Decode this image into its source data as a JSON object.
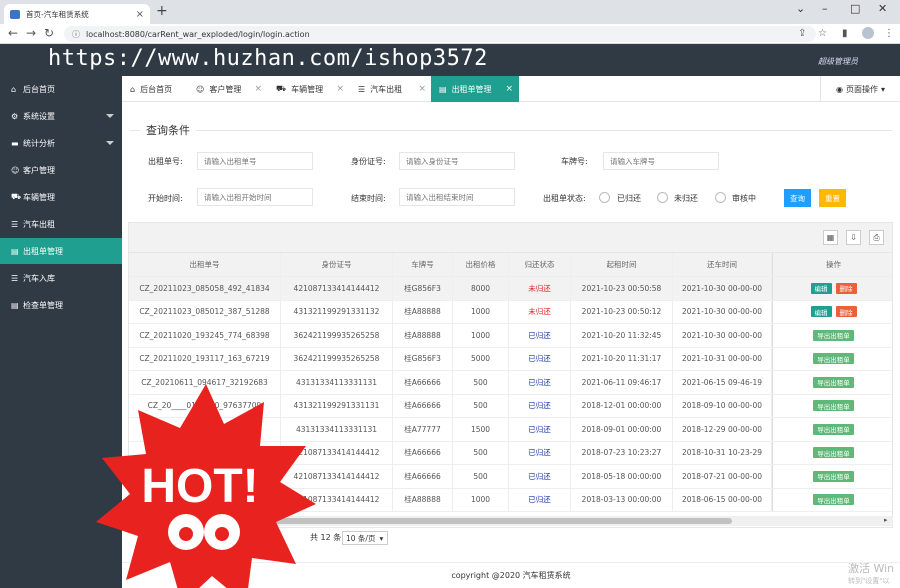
{
  "browser": {
    "tab_title": "首页-汽车租赁系统",
    "new_tab": "+",
    "url": "localhost:8080/carRent_war_exploded/login/login.action"
  },
  "header": {
    "watermark": "https://www.huzhan.com/ishop3572",
    "admin": "超级管理员"
  },
  "sidebar": {
    "items": [
      {
        "label": "后台首页",
        "icon": "home-icon"
      },
      {
        "label": "系统设置",
        "icon": "gear-icon"
      },
      {
        "label": "统计分析",
        "icon": "chart-icon"
      },
      {
        "label": "客户管理",
        "icon": "user-icon"
      },
      {
        "label": "车辆管理",
        "icon": "car-icon"
      },
      {
        "label": "汽车出租",
        "icon": "list-icon"
      },
      {
        "label": "出租单管理",
        "icon": "doc-icon"
      },
      {
        "label": "汽车入库",
        "icon": "list-icon"
      },
      {
        "label": "检查单管理",
        "icon": "doc-icon"
      }
    ]
  },
  "tabs": {
    "items": [
      {
        "label": "后台首页"
      },
      {
        "label": "客户管理"
      },
      {
        "label": "车辆管理"
      },
      {
        "label": "汽车出租"
      },
      {
        "label": "出租单管理"
      }
    ],
    "page_ops": "页面操作"
  },
  "query": {
    "title": "查询条件",
    "rent_no_label": "出租单号:",
    "rent_no_ph": "请输入出租单号",
    "idcard_label": "身份证号:",
    "idcard_ph": "请输入身份证号",
    "plate_label": "车牌号:",
    "plate_ph": "请输入车牌号",
    "start_label": "开始时间:",
    "start_ph": "请输入出租开始时间",
    "end_label": "结束时间:",
    "end_ph": "请输入出租结束时间",
    "status_label": "出租单状态:",
    "status_options": [
      "已归还",
      "未归还",
      "审核中"
    ],
    "search_btn": "查询",
    "reset_btn": "重置"
  },
  "table": {
    "columns": [
      "出租单号",
      "身份证号",
      "车牌号",
      "出租价格",
      "归还状态",
      "起租时间",
      "还车时间",
      "操作"
    ],
    "rows": [
      {
        "no": "CZ_20211023_085058_492_41834",
        "id": "421087133414144412",
        "plate": "桂G856F3",
        "price": "8000",
        "status": "未归还",
        "start": "2021-10-23 00:50:58",
        "end": "2021-10-30 00-00-00",
        "ops": [
          "编辑",
          "删除"
        ]
      },
      {
        "no": "CZ_20211023_085012_387_51288",
        "id": "431321199291331132",
        "plate": "桂A88888",
        "price": "1000",
        "status": "未归还",
        "start": "2021-10-23 00:50:12",
        "end": "2021-10-30 00-00-00",
        "ops": [
          "编辑",
          "删除"
        ]
      },
      {
        "no": "CZ_20211020_193245_774_68398",
        "id": "362421199935265258",
        "plate": "桂A88888",
        "price": "1000",
        "status": "已归还",
        "start": "2021-10-20 11:32:45",
        "end": "2021-10-30 00-00-00",
        "ops": [
          "导出出租单"
        ]
      },
      {
        "no": "CZ_20211020_193117_163_67219",
        "id": "362421199935265258",
        "plate": "桂G856F3",
        "price": "5000",
        "status": "已归还",
        "start": "2021-10-20 11:31:17",
        "end": "2021-10-31 00-00-00",
        "ops": [
          "导出出租单"
        ]
      },
      {
        "no": "CZ_20210611_094617_32192683",
        "id": "43131334113331131",
        "plate": "桂A66666",
        "price": "500",
        "status": "已归还",
        "start": "2021-06-11 09:46:17",
        "end": "2021-06-15 09-46-19",
        "ops": [
          "导出出租单"
        ]
      },
      {
        "no": "CZ_20____01_____0_97637709",
        "id": "431321199291331131",
        "plate": "桂A66666",
        "price": "500",
        "status": "已归还",
        "start": "2018-12-01 00:00:00",
        "end": "2018-09-10 00-00-00",
        "ops": [
          "导出出租单"
        ]
      },
      {
        "no": "_5",
        "id": "43131334113331131",
        "plate": "桂A77777",
        "price": "1500",
        "status": "已归还",
        "start": "2018-09-01 00:00:00",
        "end": "2018-12-29 00-00-00",
        "ops": [
          "导出出租单"
        ]
      },
      {
        "no": "",
        "id": "421087133414144412",
        "plate": "桂A66666",
        "price": "500",
        "status": "已归还",
        "start": "2018-07-23 10:23:27",
        "end": "2018-10-31 10-23-29",
        "ops": [
          "导出出租单"
        ]
      },
      {
        "no": "",
        "id": "421087133414144412",
        "plate": "桂A66666",
        "price": "500",
        "status": "已归还",
        "start": "2018-05-18 00:00:00",
        "end": "2018-07-21 00-00-00",
        "ops": [
          "导出出租单"
        ]
      },
      {
        "no": "",
        "id": "421087133414144412",
        "plate": "桂A88888",
        "price": "1000",
        "status": "已归还",
        "start": "2018-03-13 00:00:00",
        "end": "2018-06-15 00-00-00",
        "ops": [
          "导出出租单"
        ]
      }
    ]
  },
  "pager": {
    "total": "共 12 条",
    "page_size": "10 条/页"
  },
  "footer": "copyright @2020 汽车租赁系统",
  "windows_activation": {
    "line1": "激活 Win",
    "line2": "转到\"设置\"以"
  },
  "badge": {
    "text": "HOT!"
  },
  "colors": {
    "accent": "#1e9f8f",
    "sidebar": "#2f3a45",
    "unreturned": "#e02020",
    "returned": "#1a3a9a"
  }
}
